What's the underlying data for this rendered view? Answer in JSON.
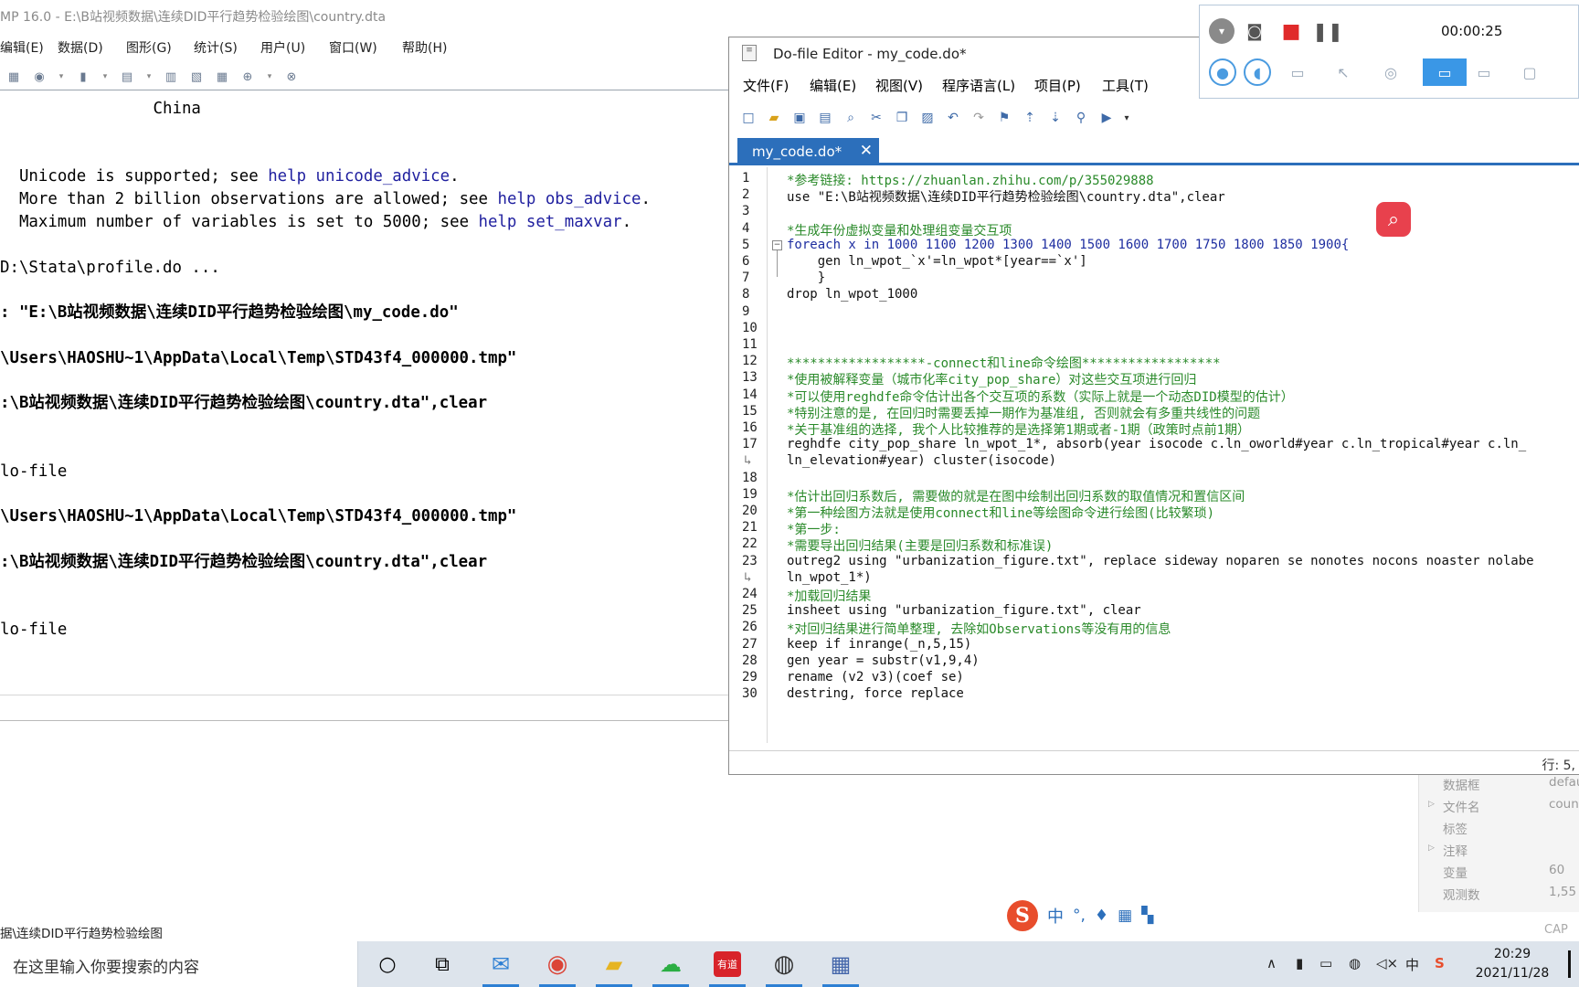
{
  "stata": {
    "title": "MP 16.0 - E:\\B站视频数据\\连续DID平行趋势检验绘图\\country.dta",
    "menu": [
      "编辑(E)",
      "数据(D)",
      "图形(G)",
      "统计(S)",
      "用户(U)",
      "窗口(W)",
      "帮助(H)"
    ],
    "results": {
      "china": "China",
      "unicode": "Unicode is supported; see ",
      "unicode_link": "help unicode_advice",
      "obs": "More than 2 billion observations are allowed; see ",
      "obs_link": "help obs_advice",
      "maxvar": "Maximum number of variables is set to 5000; see ",
      "maxvar_link": "help set_maxvar",
      "profile": "D:\\Stata\\profile.do ...",
      "do_cmd": ": \"E:\\B站视频数据\\连续DID平行趋势检验绘图\\my_code.do\"",
      "tmp1": "\\Users\\HAOSHU~1\\AppData\\Local\\Temp\\STD43f4_000000.tmp\"",
      "use1": ":\\B站视频数据\\连续DID平行趋势检验绘图\\country.dta\",clear",
      "endfile1": "lo-file",
      "tmp2": "\\Users\\HAOSHU~1\\AppData\\Local\\Temp\\STD43f4_000000.tmp\"",
      "use2": ":\\B站视频数据\\连续DID平行趋势检验绘图\\country.dta\",clear",
      "endfile2": "lo-file"
    },
    "status_path": "据\\连续DID平行趋势检验绘图",
    "properties": [
      {
        "key": "数据框",
        "value": "defau"
      },
      {
        "key": "文件名",
        "value": "coun"
      },
      {
        "key": "标签",
        "value": ""
      },
      {
        "key": "注释",
        "value": ""
      },
      {
        "key": "变量",
        "value": "60"
      },
      {
        "key": "观测数",
        "value": "1,55"
      }
    ],
    "cap": "CAP"
  },
  "editor": {
    "title": "Do-file Editor - my_code.do*",
    "menu": [
      "文件(F)",
      "编辑(E)",
      "视图(V)",
      "程序语言(L)",
      "项目(P)",
      "工具(T)"
    ],
    "tab_label": "my_code.do*",
    "tab_close": "✕",
    "status": "行: 5,",
    "code": [
      {
        "n": "1",
        "t": "*参考链接: https://zhuanlan.zhihu.com/p/355029888",
        "c": "cm"
      },
      {
        "n": "2",
        "t": "use \"E:\\B站视频数据\\连续DID平行趋势检验绘图\\country.dta\",clear",
        "c": ""
      },
      {
        "n": "3",
        "t": "",
        "c": ""
      },
      {
        "n": "4",
        "t": "*生成年份虚拟变量和处理组变量交互项",
        "c": "cm"
      },
      {
        "n": "5",
        "t": "foreach x in 1000 1100 1200 1300 1400 1500 1600 1700 1750 1800 1850 1900{",
        "c": "kw"
      },
      {
        "n": "6",
        "t": "    gen ln_wpot_`x'=ln_wpot*[year==`x']",
        "c": ""
      },
      {
        "n": "7",
        "t": "    }",
        "c": ""
      },
      {
        "n": "8",
        "t": "drop ln_wpot_1000",
        "c": ""
      },
      {
        "n": "9",
        "t": "",
        "c": ""
      },
      {
        "n": "10",
        "t": "",
        "c": ""
      },
      {
        "n": "11",
        "t": "",
        "c": ""
      },
      {
        "n": "12",
        "t": "******************-connect和line命令绘图******************",
        "c": "cm"
      },
      {
        "n": "13",
        "t": "*使用被解释变量（城市化率city_pop_share）对这些交互项进行回归",
        "c": "cm"
      },
      {
        "n": "14",
        "t": "*可以使用reghdfe命令估计出各个交互项的系数（实际上就是一个动态DID模型的估计）",
        "c": "cm"
      },
      {
        "n": "15",
        "t": "*特别注意的是, 在回归时需要丢掉一期作为基准组, 否则就会有多重共线性的问题",
        "c": "cm"
      },
      {
        "n": "16",
        "t": "*关于基准组的选择, 我个人比较推荐的是选择第1期或者-1期（政策时点前1期）",
        "c": "cm"
      },
      {
        "n": "17",
        "t": "reghdfe city_pop_share ln_wpot_1*, absorb(year isocode c.ln_oworld#year c.ln_tropical#year c.ln_",
        "c": ""
      },
      {
        "n": "",
        "t": "ln_elevation#year) cluster(isocode)",
        "c": ""
      },
      {
        "n": "18",
        "t": "",
        "c": ""
      },
      {
        "n": "19",
        "t": "*估计出回归系数后, 需要做的就是在图中绘制出回归系数的取值情况和置信区间",
        "c": "cm"
      },
      {
        "n": "20",
        "t": "*第一种绘图方法就是使用connect和line等绘图命令进行绘图(比较繁琐)",
        "c": "cm"
      },
      {
        "n": "21",
        "t": "*第一步:",
        "c": "cm"
      },
      {
        "n": "22",
        "t": "*需要导出回归结果(主要是回归系数和标准误)",
        "c": "cm"
      },
      {
        "n": "23",
        "t": "outreg2 using \"urbanization_figure.txt\", replace sideway noparen se nonotes nocons noaster nolabe",
        "c": ""
      },
      {
        "n": "",
        "t": "ln_wpot_1*)",
        "c": ""
      },
      {
        "n": "24",
        "t": "*加载回归结果",
        "c": "cm"
      },
      {
        "n": "25",
        "t": "insheet using \"urbanization_figure.txt\", clear",
        "c": ""
      },
      {
        "n": "26",
        "t": "*对回归结果进行简单整理, 去除如Observations等没有用的信息",
        "c": "cm"
      },
      {
        "n": "27",
        "t": "keep if inrange(_n,5,15)",
        "c": ""
      },
      {
        "n": "28",
        "t": "gen year = substr(v1,9,4)",
        "c": ""
      },
      {
        "n": "29",
        "t": "rename (v2 v3)(coef se)",
        "c": ""
      },
      {
        "n": "30",
        "t": "destring, force replace",
        "c": ""
      }
    ]
  },
  "recorder": {
    "time": "00:00:25"
  },
  "taskbar": {
    "search_placeholder": "在这里输入你要搜索的内容",
    "time": "20:29",
    "date": "2021/11/28",
    "youdao": "有道"
  },
  "ime": {
    "lang": "中"
  },
  "colors": {
    "accent": "#2c6fbb",
    "comment": "#2a8a2a",
    "record": "#e8414d"
  }
}
